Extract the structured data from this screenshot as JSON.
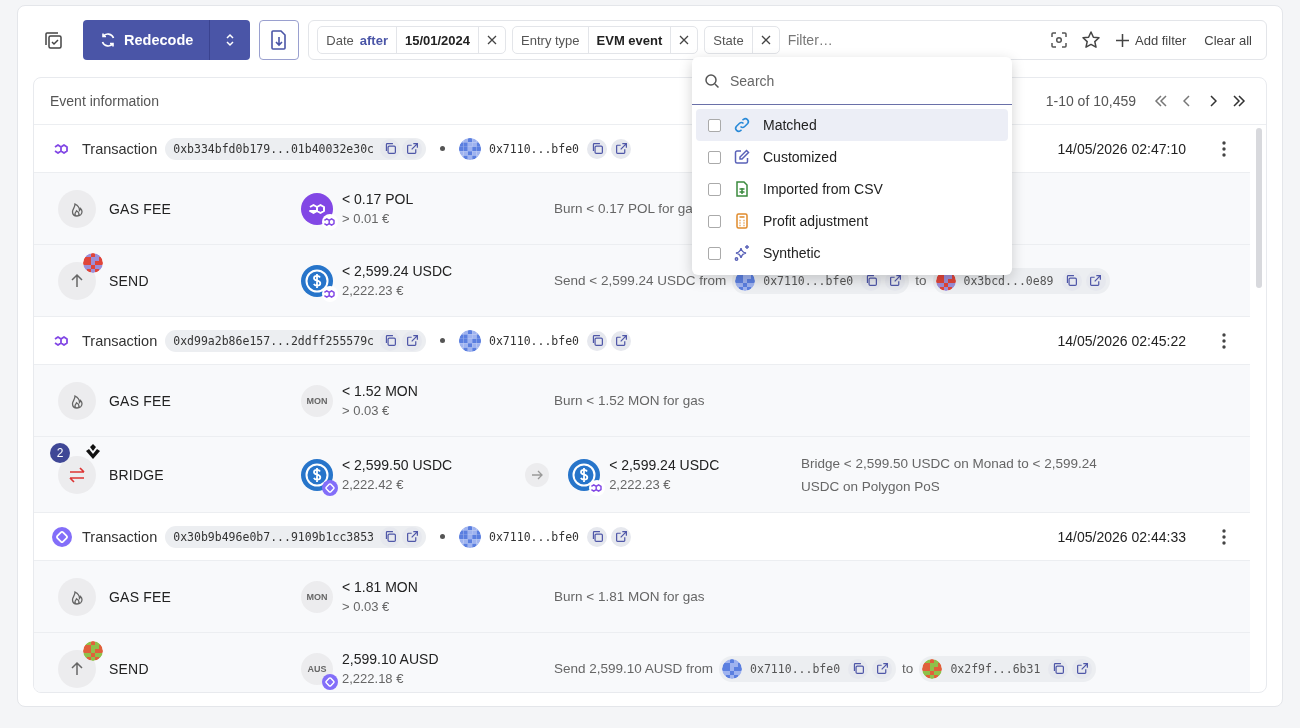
{
  "toolbar": {
    "redecode_label": "Redecode"
  },
  "filters": [
    {
      "kind": "date",
      "label": "Date",
      "operator": "after",
      "value": "15/01/2024"
    },
    {
      "kind": "value",
      "label": "Entry type",
      "value": "EVM event"
    },
    {
      "kind": "empty",
      "label": "State"
    }
  ],
  "filter_input": {
    "placeholder": "Filter…"
  },
  "add_filter": "Add filter",
  "clear_all": "Clear all",
  "table": {
    "header": "Event information",
    "pagination": "1-10 of 10,459"
  },
  "transactions": [
    {
      "chain_icon": {
        "kind": "polygon"
      },
      "label": "Transaction",
      "hash": "0xb334bfd0b179...01b40032e30c",
      "account": "0x7110...bfe0",
      "timestamp": "14/05/2026 02:47:10",
      "events": [
        {
          "kind": "gas",
          "label": "GAS FEE",
          "assets": [
            {
              "logo": {
                "kind": "pol"
              },
              "chain_badge": {
                "kind": "polygon"
              },
              "amount": "< 0.17 POL",
              "fiat": "> 0.01 €"
            }
          ],
          "description": [
            {
              "kind": "text",
              "text": "Burn < 0.17 POL for ga"
            }
          ]
        },
        {
          "kind": "send",
          "label": "SEND",
          "recipient_avatar": {
            "kind": "red"
          },
          "assets": [
            {
              "logo": {
                "kind": "usdc"
              },
              "chain_badge": {
                "kind": "polygon"
              },
              "amount": "< 2,599.24 USDC",
              "fiat": "2,222.23 €"
            }
          ],
          "description": [
            {
              "kind": "text",
              "text": "Send < 2,599.24 USDC from"
            },
            {
              "kind": "address",
              "avatar": {
                "kind": "blue"
              },
              "address": "0x7110...bfe0"
            },
            {
              "kind": "text",
              "text": "to"
            },
            {
              "kind": "address",
              "avatar": {
                "kind": "red"
              },
              "address": "0x3bcd...0e89"
            }
          ]
        }
      ]
    },
    {
      "chain_icon": {
        "kind": "polygon"
      },
      "label": "Transaction",
      "hash": "0xd99a2b86e157...2ddff255579c",
      "account": "0x7110...bfe0",
      "timestamp": "14/05/2026 02:45:22",
      "events": [
        {
          "kind": "gas",
          "label": "GAS FEE",
          "assets": [
            {
              "logo": {
                "kind": "text",
                "text": "MON"
              },
              "amount": "< 1.52 MON",
              "fiat": "> 0.03 €"
            }
          ],
          "description": [
            {
              "kind": "text",
              "text": "Burn < 1.52 MON for gas"
            }
          ]
        },
        {
          "kind": "bridge",
          "label": "BRIDGE",
          "count": "2",
          "assets": [
            {
              "logo": {
                "kind": "usdc"
              },
              "chain_badge": {
                "kind": "monad"
              },
              "amount": "< 2,599.50 USDC",
              "fiat": "2,222.42 €"
            },
            {
              "logo": {
                "kind": "usdc"
              },
              "chain_badge": {
                "kind": "polygon"
              },
              "amount": "< 2,599.24 USDC",
              "fiat": "2,222.23 €"
            }
          ],
          "description": [
            {
              "kind": "text",
              "text": "Bridge < 2,599.50 USDC on Monad to < 2,599.24 USDC on Polygon PoS"
            }
          ]
        }
      ]
    },
    {
      "chain_icon": {
        "kind": "monad"
      },
      "label": "Transaction",
      "hash": "0x30b9b496e0b7...9109b1cc3853",
      "account": "0x7110...bfe0",
      "timestamp": "14/05/2026 02:44:33",
      "events": [
        {
          "kind": "gas",
          "label": "GAS FEE",
          "assets": [
            {
              "logo": {
                "kind": "text",
                "text": "MON"
              },
              "amount": "< 1.81 MON",
              "fiat": "> 0.03 €"
            }
          ],
          "description": [
            {
              "kind": "text",
              "text": "Burn < 1.81 MON for gas"
            }
          ]
        },
        {
          "kind": "send",
          "label": "SEND",
          "recipient_avatar": {
            "kind": "orange"
          },
          "assets": [
            {
              "logo": {
                "kind": "text",
                "text": "AUS"
              },
              "chain_badge": {
                "kind": "monad"
              },
              "amount": "2,599.10 AUSD",
              "fiat": "2,222.18 €"
            }
          ],
          "description": [
            {
              "kind": "text",
              "text": "Send 2,599.10 AUSD from"
            },
            {
              "kind": "address",
              "avatar": {
                "kind": "blue"
              },
              "address": "0x7110...bfe0"
            },
            {
              "kind": "text",
              "text": "to"
            },
            {
              "kind": "address",
              "avatar": {
                "kind": "orange"
              },
              "address": "0x2f9f...6b31"
            }
          ]
        }
      ]
    }
  ],
  "state_menu": {
    "search_placeholder": "Search",
    "options": [
      {
        "kind": "matched",
        "label": "Matched",
        "checked": false,
        "highlighted": true
      },
      {
        "kind": "customized",
        "label": "Customized",
        "checked": false,
        "highlighted": false
      },
      {
        "kind": "csv",
        "label": "Imported from CSV",
        "checked": false,
        "highlighted": false
      },
      {
        "kind": "adjustment",
        "label": "Profit adjustment",
        "checked": false,
        "highlighted": false
      },
      {
        "kind": "synthetic",
        "label": "Synthetic",
        "checked": false,
        "highlighted": false
      }
    ]
  }
}
